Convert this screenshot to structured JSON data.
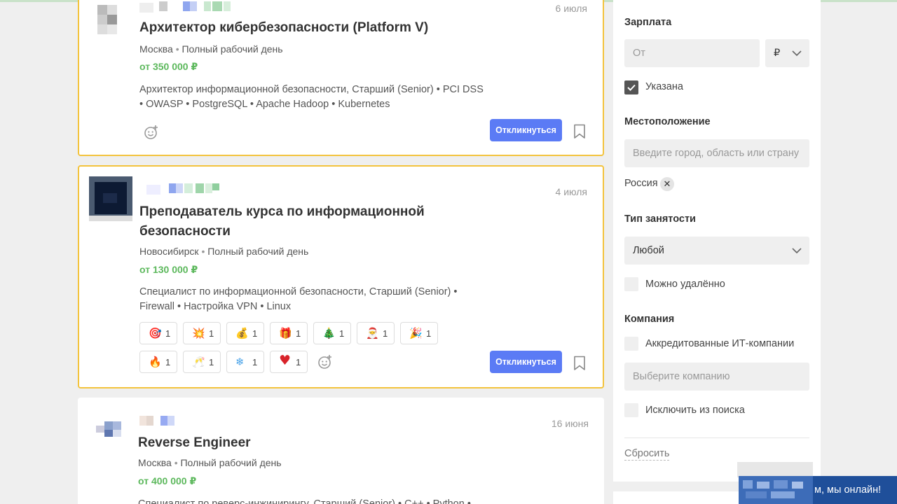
{
  "jobs": [
    {
      "date": "6 июля",
      "title": "Архитектор кибербезопасности (Platform V)",
      "location": "Москва",
      "employment": "Полный рабочий день",
      "salary": "от 350 000 ₽",
      "skills_line1": "Архитектор информационной безопасности, Старший (Senior) • PCI DSS",
      "skills_line2": "• OWASP • PostgreSQL • Apache Hadoop • Kubernetes",
      "apply_label": "Откликнуться"
    },
    {
      "date": "4 июля",
      "title_line1": "Преподаватель курса по информационной",
      "title_line2": "безопасности",
      "location": "Новосибирск",
      "employment": "Полный рабочий день",
      "salary": "от 130 000 ₽",
      "skills_line1": "Специалист по информационной безопасности, Старший (Senior) •",
      "skills_line2": "Firewall • Настройка VPN • Linux",
      "apply_label": "Откликнуться",
      "reactions": [
        {
          "emoji": "🎯",
          "count": "1"
        },
        {
          "emoji": "💥",
          "count": "1"
        },
        {
          "emoji": "💰",
          "count": "1"
        },
        {
          "emoji": "🎁",
          "count": "1"
        },
        {
          "emoji": "🎄",
          "count": "1"
        },
        {
          "emoji": "🎅",
          "count": "1"
        },
        {
          "emoji": "🎉",
          "count": "1"
        },
        {
          "emoji": "🔥",
          "count": "1"
        },
        {
          "emoji": "🥂",
          "count": "1"
        },
        {
          "emoji": "❄",
          "count": "1"
        },
        {
          "emoji": "♥",
          "count": "1"
        }
      ]
    },
    {
      "date": "16 июня",
      "title": "Reverse Engineer",
      "location": "Москва",
      "employment": "Полный рабочий день",
      "salary": "от 400 000 ₽",
      "skills_line1": "Специалист по реверс-инжинирингу, Старший (Senior) • C++ • Python •"
    }
  ],
  "meta_separator": "•",
  "filters": {
    "salary": {
      "heading": "Зарплата",
      "from_placeholder": "От",
      "currency": "₽",
      "specified_label": "Указана",
      "specified_checked": true
    },
    "location": {
      "heading": "Местоположение",
      "placeholder": "Введите город, область или страну",
      "selected_tag": "Россия",
      "tag_remove": "✕"
    },
    "employment": {
      "heading": "Тип занятости",
      "selected": "Любой",
      "remote_label": "Можно удалённо"
    },
    "company": {
      "heading": "Компания",
      "accredited_label": "Аккредитованные ИТ-компании",
      "placeholder": "Выберите компанию",
      "exclude_label": "Исключить из поиска"
    },
    "reset_label": "Сбросить"
  },
  "chat": {
    "text": "м, мы онлайн!"
  },
  "colors": {
    "accent": "#5b7bf5",
    "highlight_border": "#f3c33d",
    "salary": "#5cb85c",
    "chat_bg": "#1f4f9a"
  }
}
